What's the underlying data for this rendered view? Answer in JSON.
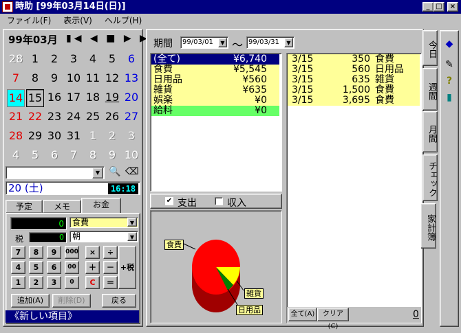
{
  "window": {
    "title": "時助 [99年03月14日(日)]",
    "minimize": "_",
    "maximize": "□",
    "close": "×"
  },
  "menu": [
    "ファイル(F)",
    "表示(V)",
    "ヘルプ(H)"
  ],
  "calendar": {
    "title": "99年03月",
    "nav": "▮◀ ◀ ■ ▶ ▶▮",
    "weeks": [
      [
        "28",
        "1",
        "2",
        "3",
        "4",
        "5",
        "6"
      ],
      [
        "7",
        "8",
        "9",
        "10",
        "11",
        "12",
        "13"
      ],
      [
        "14",
        "15",
        "16",
        "17",
        "18",
        "19",
        "20"
      ],
      [
        "21",
        "22",
        "23",
        "24",
        "25",
        "26",
        "27"
      ],
      [
        "28",
        "29",
        "30",
        "31",
        "1",
        "2",
        "3"
      ],
      [
        "4",
        "5",
        "6",
        "7",
        "8",
        "9",
        "10"
      ]
    ],
    "selected_date": "20 (土)",
    "clock": "16:18"
  },
  "left_tabs": [
    "予定",
    "メモ",
    "お金"
  ],
  "money": {
    "amount": "0",
    "tax_label": "税",
    "tax_amount": "0",
    "category": "食費",
    "time": "朝",
    "keys": [
      "7",
      "8",
      "9",
      "000",
      "×",
      "÷",
      "4",
      "5",
      "6",
      "00",
      "＋",
      "－",
      "1",
      "2",
      "3",
      "0",
      "C",
      "＝"
    ],
    "tax_button": "+税",
    "add_button": "追加(A)",
    "delete_button": "削除(D)",
    "back_button": "戻る",
    "new_item": "《新しい項目》"
  },
  "period": {
    "label": "期間",
    "from": "99/03/01",
    "tilde": "～",
    "to": "99/03/31"
  },
  "categories": [
    {
      "name": "(全て)",
      "amount": "¥6,740"
    },
    {
      "name": "食費",
      "amount": "¥5,545"
    },
    {
      "name": "日用品",
      "amount": "¥560"
    },
    {
      "name": "雑貨",
      "amount": "¥635"
    },
    {
      "name": "娯楽",
      "amount": "¥0"
    },
    {
      "name": "給料",
      "amount": "¥0"
    }
  ],
  "transactions": [
    {
      "date": "3/15",
      "amount": "350",
      "category": "食費"
    },
    {
      "date": "3/15",
      "amount": "560",
      "category": "日用品"
    },
    {
      "date": "3/15",
      "amount": "635",
      "category": "雑貨"
    },
    {
      "date": "3/15",
      "amount": "1,500",
      "category": "食費"
    },
    {
      "date": "3/15",
      "amount": "3,695",
      "category": "食費"
    }
  ],
  "filter": {
    "expense": "支出",
    "income": "収入",
    "expense_checked": "✔",
    "income_checked": ""
  },
  "pie_labels": {
    "food": "食費",
    "goods": "雑貨",
    "daily": "日用品"
  },
  "bottom_buttons": {
    "all": "全て(A)",
    "clear": "クリア(C)",
    "count": "0"
  },
  "right_tabs": [
    "今日",
    "週間",
    "月間",
    "チェック",
    "家計簿"
  ],
  "colors": {
    "title_bg": "#000080",
    "highlight": "#ffff99",
    "selected": "#00cc66",
    "pie_red": "#ff0000"
  }
}
